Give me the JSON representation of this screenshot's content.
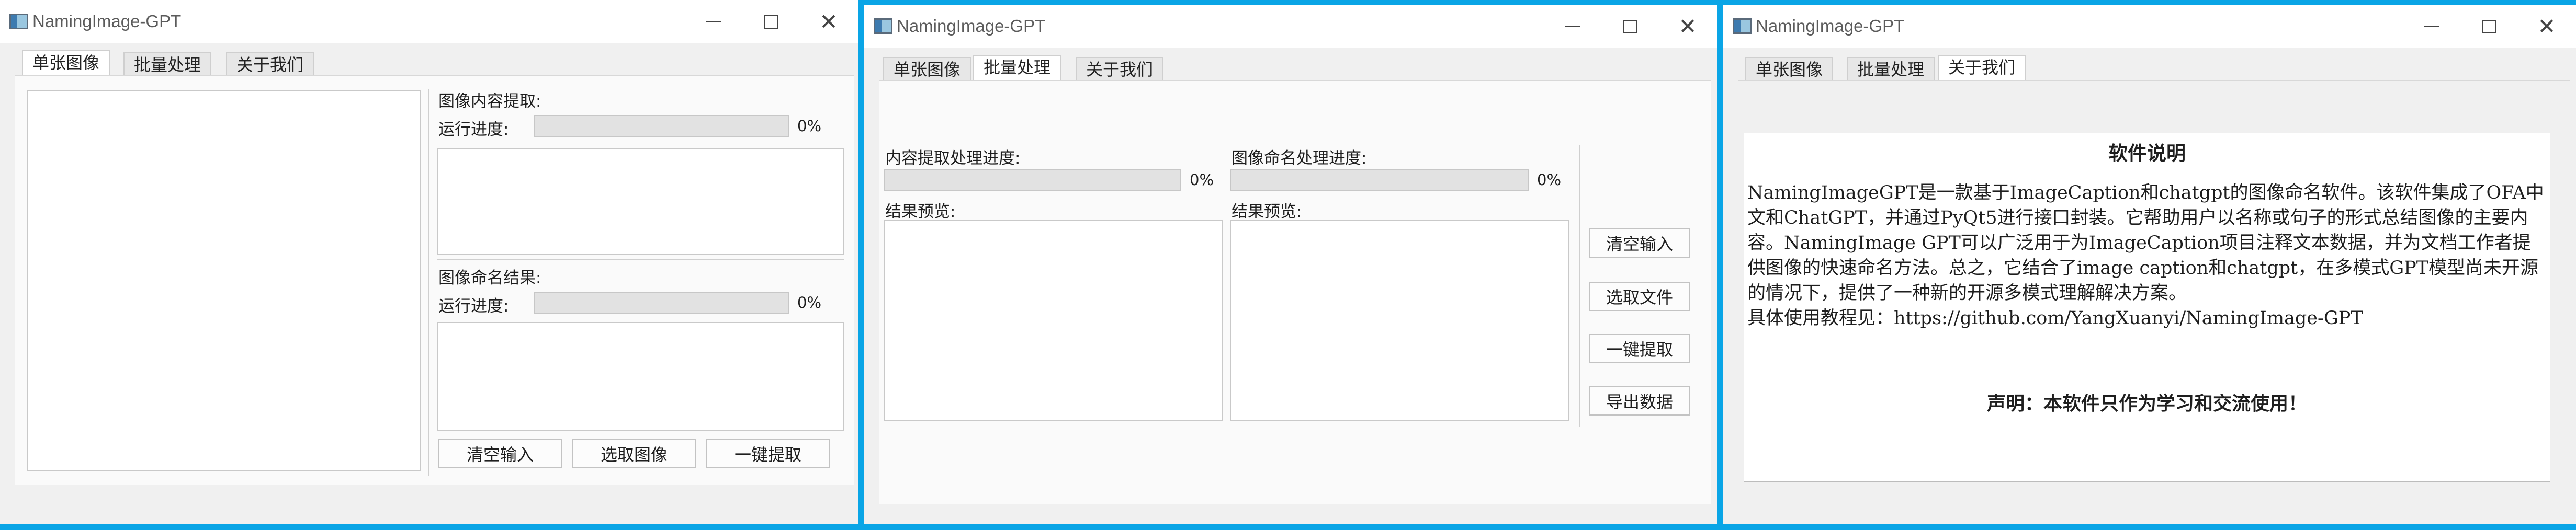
{
  "app": {
    "title": "NamingImage-GPT"
  },
  "window_controls": {
    "minimize": "—",
    "maximize": "□",
    "close": "✕"
  },
  "tabs": [
    "单张图像",
    "批量处理",
    "关于我们"
  ],
  "single": {
    "content_title": "图像内容提取:",
    "progress_label": "运行进度:",
    "progress_value": "0%",
    "naming_title": "图像命名结果:",
    "naming_progress_label": "运行进度:",
    "naming_progress_value": "0%",
    "buttons": {
      "clear": "清空输入",
      "select": "选取图像",
      "extract": "一键提取"
    }
  },
  "batch": {
    "content_progress_title": "内容提取处理进度:",
    "content_progress_value": "0%",
    "content_preview": "结果预览:",
    "naming_progress_title": "图像命名处理进度:",
    "naming_progress_value": "0%",
    "naming_preview": "结果预览:",
    "buttons": {
      "clear": "清空输入",
      "select": "选取文件",
      "extract": "一键提取",
      "export": "导出数据"
    }
  },
  "about": {
    "heading": "软件说明",
    "body": "NamingImageGPT是一款基于ImageCaption和chatgpt的图像命名软件。该软件集成了OFA中文和ChatGPT，并通过PyQt5进行接口封装。它帮助用户以名称或句子的形式总结图像的主要内容。NamingImage GPT可以广泛用于为ImageCaption项目注释文本数据，并为文档工作者提供图像的快速命名方法。总之，它结合了image caption和chatgpt，在多模式GPT模型尚未开源的情况下，提供了一种新的开源多模式理解解决方案。",
    "tutorial": "具体使用教程见：https://github.com/YangXuanyi/NamingImage-GPT",
    "statement": "声明：本软件只作为学习和交流使用！"
  }
}
